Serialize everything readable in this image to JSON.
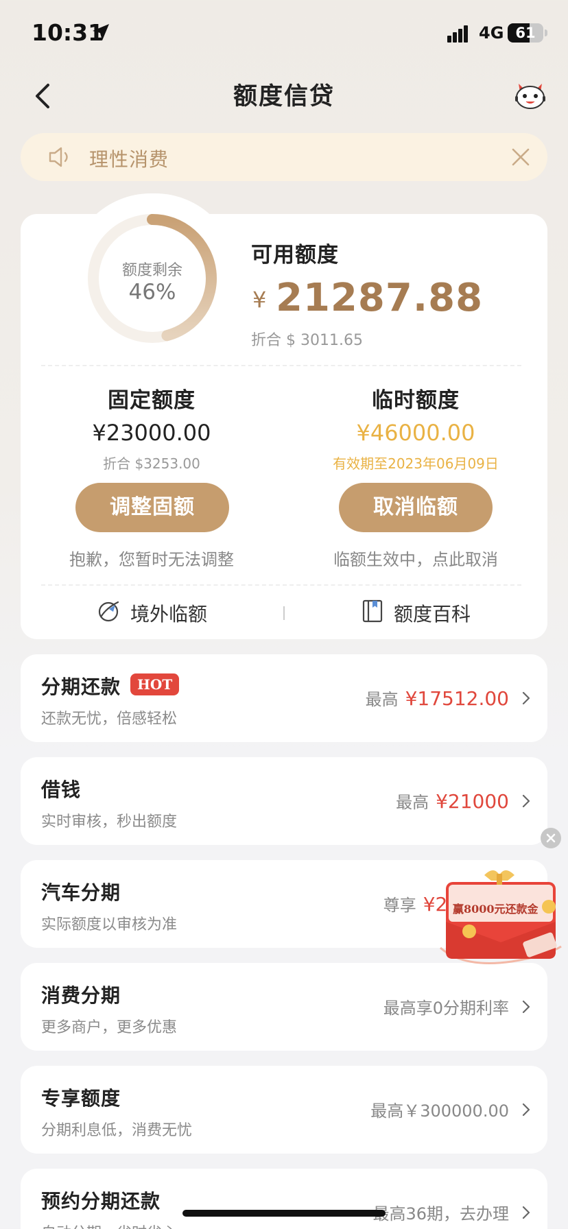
{
  "status_bar": {
    "time": "10:31",
    "network": "4G",
    "battery": "61",
    "battery_level": 0.61
  },
  "nav": {
    "title": "额度信贷",
    "back_icon": "chevron-left-icon",
    "mascot_icon": "mascot-icon"
  },
  "notice": {
    "text": "理性消费",
    "icon": "speaker-icon",
    "close_icon": "close-icon"
  },
  "credit": {
    "ring_caption": "额度剩余",
    "ring_percent": "46%",
    "ring_fraction": 0.46,
    "available_title": "可用额度",
    "currency": "¥",
    "available_amount": "21287.88",
    "available_converted": "折合 $ 3011.65",
    "fixed": {
      "title": "固定额度",
      "amount": "¥23000.00",
      "sub": "折合 $3253.00",
      "button": "调整固额",
      "note": "抱歉，您暂时无法调整"
    },
    "temporary": {
      "title": "临时额度",
      "amount": "¥46000.00",
      "sub": "有效期至2023年06月09日",
      "button": "取消临额",
      "note": "临额生效中，点此取消"
    },
    "links": [
      {
        "label": "境外临额",
        "icon": "globe-plane-icon"
      },
      {
        "label": "额度百科",
        "icon": "book-icon"
      }
    ]
  },
  "list": [
    {
      "title": "分期还款",
      "badge": "HOT",
      "sub": "还款无忧，倍感轻松",
      "prefix": "最高",
      "value": "¥17512.00"
    },
    {
      "title": "借钱",
      "sub": "实时审核，秒出额度",
      "prefix": "最高",
      "value": "¥21000"
    },
    {
      "title": "汽车分期",
      "sub": "实际额度以审核为准",
      "prefix": "尊享",
      "value": "¥288"
    },
    {
      "title": "消费分期",
      "sub": "更多商户，更多优惠",
      "prefix": "最高享0分期利率",
      "value": ""
    },
    {
      "title": "专享额度",
      "sub": "分期利息低，消费无忧",
      "prefix": "最高￥300000.00",
      "value": ""
    },
    {
      "title": "预约分期还款",
      "sub": "自动分期，省时省心",
      "prefix": "最高36期，去办理",
      "value": ""
    }
  ],
  "promo": {
    "text": "赢8000元还款金",
    "icon": "red-envelope-icon",
    "close_icon": "close-icon"
  },
  "colors": {
    "accent_gold": "#c69d6e",
    "amount_brown": "#a67c52",
    "temp_gold": "#e9b244",
    "red": "#e0473c"
  }
}
